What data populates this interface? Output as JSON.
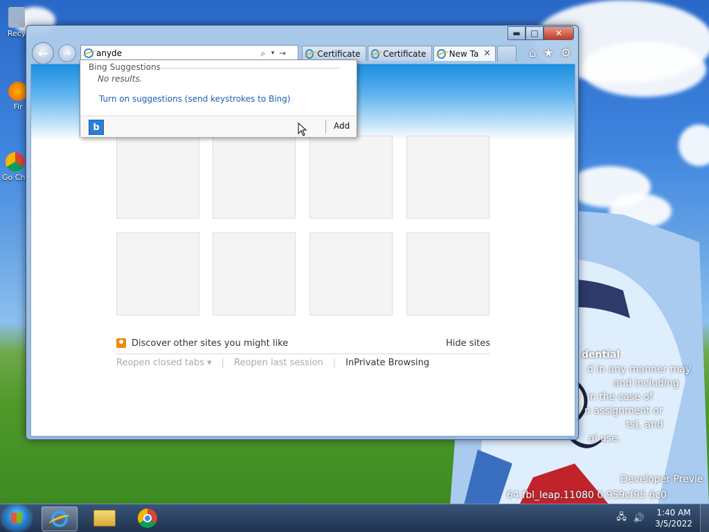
{
  "desktop": {
    "icons": [
      {
        "label": "Recy",
        "color": "#9fb3c8"
      },
      {
        "label": "Fir",
        "color": "#e66000"
      },
      {
        "label": "Go Chr",
        "color": "#db4437"
      }
    ],
    "watermark": {
      "heading": "dential",
      "lines": [
        "d in any manner may",
        "and including",
        "in the case of",
        "n assignment or",
        "ts), and",
        "al use."
      ],
      "build_line_1": "Developer Previe",
      "build_line_2": "64.fbl_leap.11080 0.959cf95 6c0"
    }
  },
  "browser": {
    "address": {
      "value": "anyde",
      "search_icon": "search-icon",
      "dropdown_icon": "chevron-down-icon",
      "go_icon": "arrow-right-icon"
    },
    "tabs": [
      {
        "label": "Certificate ...",
        "active": false
      },
      {
        "label": "Certificate ...",
        "active": false
      },
      {
        "label": "New Tab",
        "active": true,
        "close": "✕"
      }
    ],
    "toolbar": {
      "home": "⌂",
      "favorites": "★",
      "settings": "⚙"
    },
    "caption": {
      "minimize": "▬",
      "maximize": "□",
      "close": "✕"
    },
    "nav": {
      "back": "←",
      "forward": "→"
    }
  },
  "suggestions": {
    "title": "Bing Suggestions",
    "no_results": "No results.",
    "turn_on": "Turn on suggestions (send keystrokes to Bing)",
    "bing_glyph": "b",
    "add_label": "Add"
  },
  "new_tab": {
    "discover": "Discover other sites you might like",
    "hide_sites": "Hide sites",
    "reopen_closed": "Reopen closed tabs ▾",
    "reopen_last": "Reopen last session",
    "inprivate": "InPrivate Browsing"
  },
  "taskbar": {
    "clock_time": "1:40 AM",
    "clock_date": "3/5/2022",
    "network_icon": "network-icon",
    "volume_icon": "volume-icon"
  }
}
